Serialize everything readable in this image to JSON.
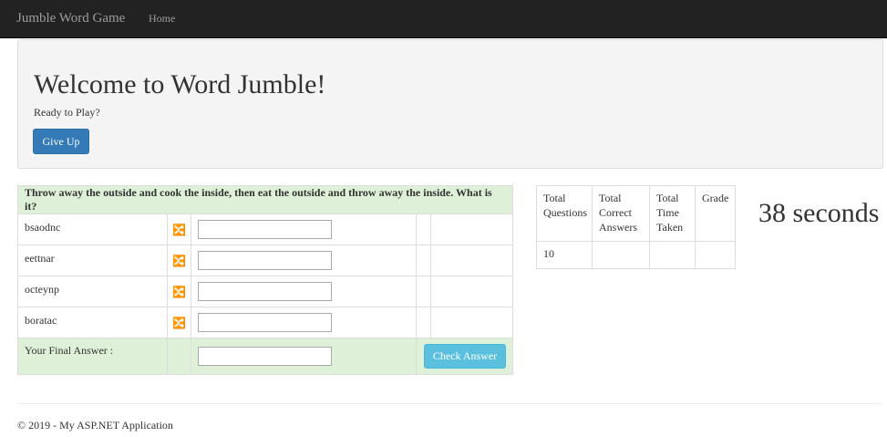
{
  "navbar": {
    "brand": "Jumble Word Game",
    "home": "Home"
  },
  "jumbotron": {
    "title": "Welcome to Word Jumble!",
    "subtitle": "Ready to Play?",
    "give_up_label": "Give Up"
  },
  "question": {
    "text": "Throw away the outside and cook the inside, then eat the outside and throw away the inside. What is it?",
    "words": [
      {
        "jumbled": "bsaodnc",
        "icon": "shuffle-icon",
        "answer": ""
      },
      {
        "jumbled": "eettnar",
        "icon": "shuffle-icon",
        "answer": ""
      },
      {
        "jumbled": "octeynp",
        "icon": "shuffle-icon",
        "answer": ""
      },
      {
        "jumbled": "boratac",
        "icon": "shuffle-icon",
        "answer": ""
      }
    ],
    "final_label": "Your Final Answer :",
    "final_answer": "",
    "check_label": "Check Answer"
  },
  "stats": {
    "headers": [
      [
        "Total",
        "Questions"
      ],
      [
        "Total",
        "Correct",
        "Answers"
      ],
      [
        "Total",
        "Time",
        "Taken"
      ],
      [
        "Grade"
      ]
    ],
    "values": [
      "10",
      "",
      "",
      ""
    ]
  },
  "timer": "38 seconds",
  "footer": "© 2019 - My ASP.NET Application",
  "colors": {
    "navbar": "#222222",
    "primary_button": "#337ab7",
    "info_button": "#5bc0de",
    "success_row": "#dff0d8",
    "jumbotron": "#f4f4f4"
  }
}
